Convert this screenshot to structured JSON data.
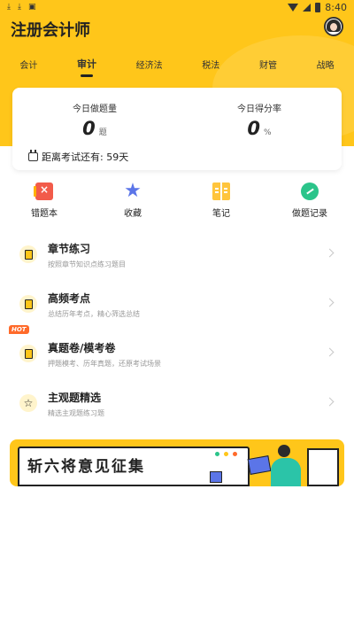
{
  "status_bar": {
    "time": "8:40"
  },
  "app": {
    "title": "注册会计师"
  },
  "tabs": [
    {
      "label": "会计"
    },
    {
      "label": "审计",
      "active": true
    },
    {
      "label": "经济法"
    },
    {
      "label": "税法"
    },
    {
      "label": "财管"
    },
    {
      "label": "战略"
    }
  ],
  "stats": {
    "questions_label": "今日做题量",
    "questions_value": "0",
    "questions_unit": "题",
    "score_label": "今日得分率",
    "score_value": "0",
    "score_unit": "%",
    "countdown": "距离考试还有: 59天"
  },
  "quick_actions": [
    {
      "label": "错题本",
      "icon": "wrong-book-icon"
    },
    {
      "label": "收藏",
      "icon": "favorite-star-icon"
    },
    {
      "label": "笔记",
      "icon": "notes-icon"
    },
    {
      "label": "做题记录",
      "icon": "record-icon"
    }
  ],
  "list": [
    {
      "title": "章节练习",
      "subtitle": "按照章节知识点练习题目",
      "icon": "document-icon"
    },
    {
      "title": "高频考点",
      "subtitle": "总结历年考点，精心筛选总结",
      "icon": "clipboard-icon"
    },
    {
      "title": "真题卷/模考卷",
      "subtitle": "押题模考、历年真题，还原考试场景",
      "icon": "paper-icon",
      "badge": "HOT"
    },
    {
      "title": "主观题精选",
      "subtitle": "精选主观题练习题",
      "icon": "star-icon"
    }
  ],
  "banner": {
    "text": "斩六将意见征集"
  },
  "colors": {
    "brand_yellow": "#ffc61a",
    "hot_orange": "#ff6a2a",
    "accent_blue": "#5b75e8",
    "accent_green": "#2bc48a"
  }
}
